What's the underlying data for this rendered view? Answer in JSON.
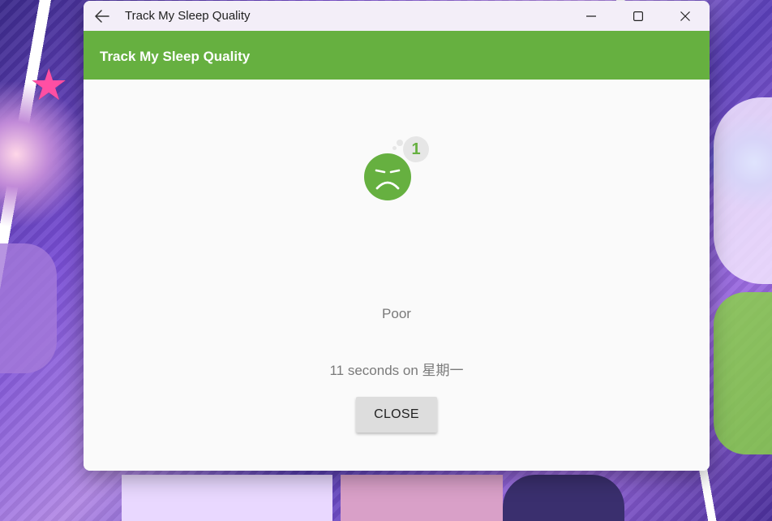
{
  "window": {
    "title": "Track My Sleep Quality",
    "back_icon": "back-arrow-icon",
    "minimize_icon": "minimize-icon",
    "maximize_icon": "maximize-icon",
    "close_icon": "close-icon"
  },
  "appbar": {
    "title": "Track My Sleep Quality",
    "color": "#66b040"
  },
  "detail": {
    "quality_icon": "sad-face-icon",
    "quality_badge": "1",
    "quality_label": "Poor",
    "duration_text": "11 seconds on 星期一",
    "close_label": "CLOSE"
  },
  "colors": {
    "accent": "#66b040",
    "text_muted": "#7a7a7a",
    "button_bg": "#dddddd"
  }
}
